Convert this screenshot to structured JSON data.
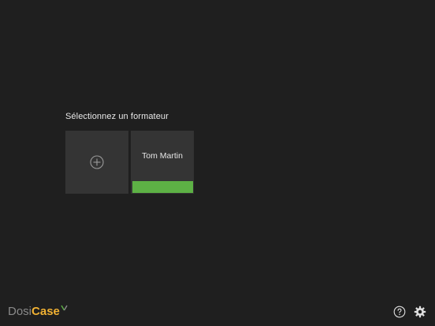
{
  "screen": {
    "title": "Sélectionnez un formateur"
  },
  "trainers": {
    "add_icon": "plus-circle-icon",
    "items": [
      {
        "name": "Tom Martin",
        "status_color": "#5db145"
      }
    ]
  },
  "footer": {
    "logo_part1": "Dosi",
    "logo_part2": "Case",
    "help_icon": "help-circle-icon",
    "settings_icon": "gear-icon"
  },
  "colors": {
    "background": "#1f1f1f",
    "tile": "#343434",
    "accent_yellow": "#f2b233",
    "accent_green": "#5db145",
    "text": "#e8e8e8"
  }
}
